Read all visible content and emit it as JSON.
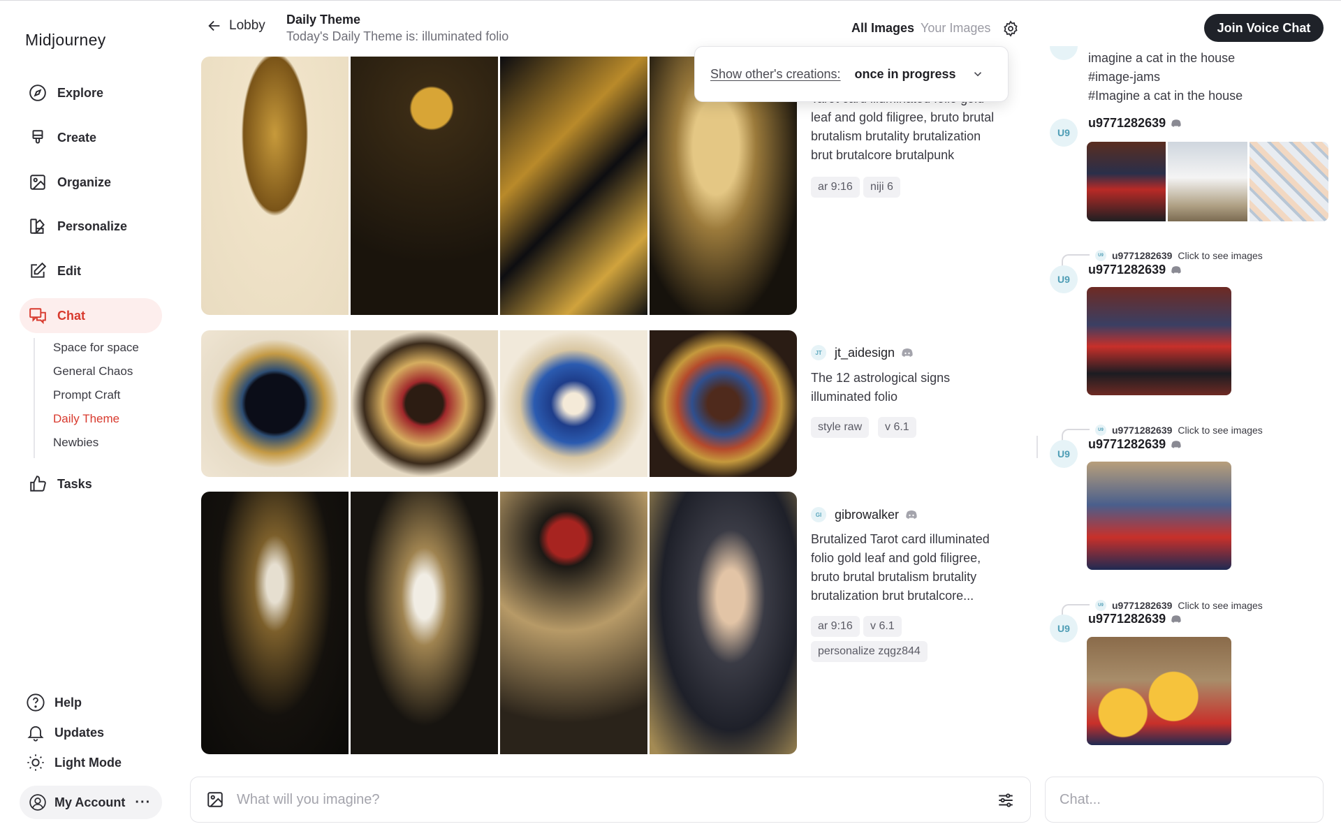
{
  "app": {
    "brand": "Midjourney"
  },
  "sidebar": {
    "items": [
      {
        "label": "Explore",
        "icon": "compass-icon"
      },
      {
        "label": "Create",
        "icon": "brush-icon"
      },
      {
        "label": "Organize",
        "icon": "image-icon"
      },
      {
        "label": "Personalize",
        "icon": "palette-icon"
      },
      {
        "label": "Edit",
        "icon": "edit-icon"
      },
      {
        "label": "Chat",
        "icon": "chat-icon",
        "active": true
      },
      {
        "label": "Tasks",
        "icon": "thumbs-up-icon"
      }
    ],
    "channels": [
      {
        "label": "Space for space"
      },
      {
        "label": "General Chaos"
      },
      {
        "label": "Prompt Craft"
      },
      {
        "label": "Daily Theme",
        "active": true
      },
      {
        "label": "Newbies"
      }
    ],
    "bottom": [
      {
        "label": "Help",
        "icon": "help-icon"
      },
      {
        "label": "Updates",
        "icon": "bell-icon"
      },
      {
        "label": "Light Mode",
        "icon": "sun-icon"
      }
    ],
    "account": {
      "label": "My Account",
      "more": "···"
    }
  },
  "header": {
    "back_label": "Lobby",
    "title": "Daily Theme",
    "subtitle": "Today's Daily Theme is: illuminated folio",
    "tabs": [
      "All Images",
      "Your Images"
    ],
    "voice_button": "Join Voice Chat"
  },
  "filter_popup": {
    "label": "Show other's creations:",
    "value": "once in progress"
  },
  "feed": [
    {
      "prompt_lines": [
        "Tarot card illuminated folio gold",
        "leaf and gold filigree, bruto brutal",
        "brutalism brutality brutalization",
        "brut brutalcore brutalpunk"
      ],
      "chips": [
        "ar 9:16",
        "niji 6"
      ]
    },
    {
      "author": "jt_aidesign",
      "author_initials": "JT",
      "prompt_lines": [
        "The 12 astrological signs",
        "illuminated folio"
      ],
      "chips": [
        "style raw",
        "v 6.1"
      ]
    },
    {
      "author": "gibrowalker",
      "author_initials": "GI",
      "prompt_lines": [
        "Brutalized Tarot card illuminated",
        "folio gold leaf and gold filigree,",
        "bruto brutal brutalism brutality",
        "brutalization brut brutalcore..."
      ],
      "chips": [
        "ar 9:16",
        "v 6.1",
        "personalize zqgz844"
      ]
    }
  ],
  "chat": {
    "top_lines": [
      "imagine a cat in the house",
      "#image-jams",
      "#Imagine a cat in the house"
    ],
    "avatar_initials": "U9",
    "reply_initials": "U9",
    "user": "u9771282639",
    "reply_hint": "Click to see images"
  },
  "inputs": {
    "imagine_placeholder": "What will you imagine?",
    "chat_placeholder": "Chat..."
  },
  "colors": {
    "accent": "#d83a2e",
    "active_bg": "#fdeeed",
    "voice_button_bg": "#1f2229",
    "avatar_bg": "#e6f3f7"
  }
}
